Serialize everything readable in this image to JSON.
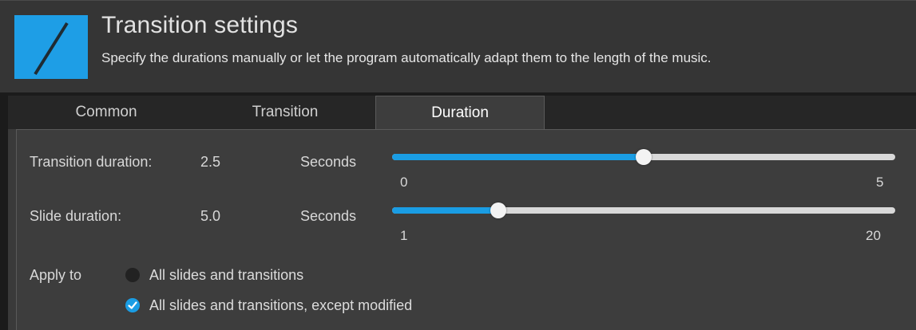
{
  "header": {
    "title": "Transition settings",
    "subtitle": "Specify the durations manually or let the program automatically adapt them to the length of the music.",
    "logo_icon": "app-logo-icon",
    "accent_color": "#1a9de4"
  },
  "tabs": [
    {
      "label": "Common",
      "active": false
    },
    {
      "label": "Transition",
      "active": false
    },
    {
      "label": "Duration",
      "active": true
    }
  ],
  "transition_duration": {
    "label": "Transition duration:",
    "value": "2.5",
    "unit": "Seconds",
    "min_label": "0",
    "max_label": "5",
    "min": 0,
    "max": 5,
    "current": 2.5
  },
  "slide_duration": {
    "label": "Slide duration:",
    "value": "5.0",
    "unit": "Seconds",
    "min_label": "1",
    "max_label": "20",
    "min": 1,
    "max": 20,
    "current": 5.0
  },
  "apply_to": {
    "label": "Apply to",
    "options": [
      {
        "label": "All slides and transitions",
        "selected": false
      },
      {
        "label": "All slides and transitions, except modified",
        "selected": true
      }
    ]
  }
}
